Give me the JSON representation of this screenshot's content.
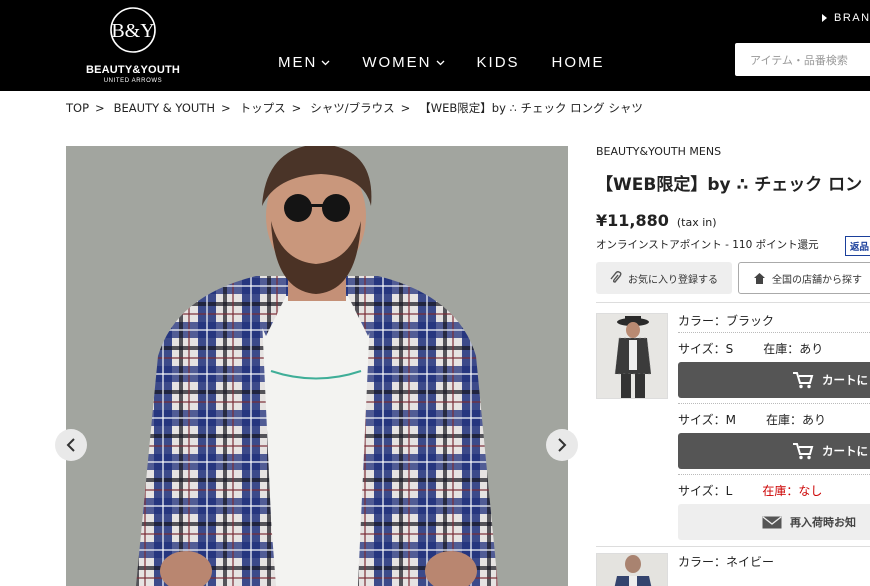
{
  "header": {
    "logo_mark": "B&Y",
    "logo_name": "BEAUTY&YOUTH",
    "logo_sub": "UNITED ARROWS",
    "nav": [
      {
        "label": "MEN",
        "has_dropdown": true
      },
      {
        "label": "WOMEN",
        "has_dropdown": true
      },
      {
        "label": "KIDS",
        "has_dropdown": false
      },
      {
        "label": "HOME",
        "has_dropdown": false
      }
    ],
    "brand_link": "BRAN",
    "search_placeholder": "アイテム・品番検索"
  },
  "breadcrumb": [
    {
      "label": "TOP"
    },
    {
      "label": "BEAUTY & YOUTH"
    },
    {
      "label": "トップス"
    },
    {
      "label": "シャツ/ブラウス"
    },
    {
      "label": "【WEB限定】by ∴ チェック ロング シャツ"
    }
  ],
  "product": {
    "brand": "BEAUTY&YOUTH MENS",
    "title": "【WEB限定】by ∴ チェック ロン",
    "price": "¥11,880",
    "tax": "(tax in)",
    "points": "オンラインストアポイント - 110 ポイント還元",
    "returns_badge": "返品",
    "favorite_label": "お気に入り登録する",
    "store_label": "全国の店舗から探す"
  },
  "variants": [
    {
      "color_label": "カラー：ブラック",
      "sizes": [
        {
          "size": "サイズ：S",
          "stock": "在庫：あり",
          "in_stock": true,
          "button": "カートに"
        },
        {
          "size": "サイズ：M",
          "stock": "在庫：あり",
          "in_stock": true,
          "button": "カートに"
        },
        {
          "size": "サイズ：L",
          "stock": "在庫：なし",
          "in_stock": false,
          "button": "再入荷時お知"
        }
      ]
    },
    {
      "color_label": "カラー：ネイビー"
    }
  ],
  "colors": {
    "header_bg": "#000000",
    "cart_button": "#555555",
    "out_of_stock": "#cc0000",
    "returns_badge": "#1a3f9b"
  }
}
